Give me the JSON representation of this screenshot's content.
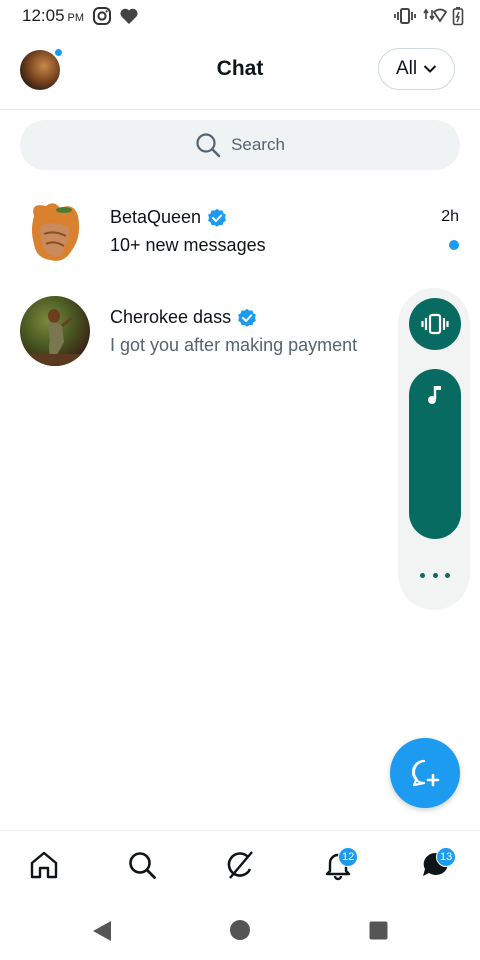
{
  "status_bar": {
    "time": "12:05",
    "ampm": "PM"
  },
  "header": {
    "title": "Chat",
    "filter_label": "All"
  },
  "search": {
    "placeholder": "Search"
  },
  "conversations": [
    {
      "name": "BetaQueen",
      "verified": true,
      "preview": "10+ new messages",
      "time": "2h",
      "unread": true
    },
    {
      "name": "Cherokee dass",
      "verified": true,
      "preview": "I got you after making payment",
      "time": "",
      "unread": false
    }
  ],
  "volume_panel": {
    "accent": "#086b62",
    "mode_icon": "vibrate-icon",
    "slider_icon": "music-note-icon",
    "more_icon": "more-icon"
  },
  "fab": {
    "icon": "new-message-icon"
  },
  "bottom_nav": {
    "items": [
      "home-icon",
      "search-icon",
      "grok-icon",
      "notifications-icon",
      "messages-icon"
    ],
    "notifications_badge": "12",
    "messages_badge": "13"
  },
  "colors": {
    "accent": "#1d9bf0",
    "text_primary": "#0f1419",
    "text_secondary": "#536471"
  }
}
